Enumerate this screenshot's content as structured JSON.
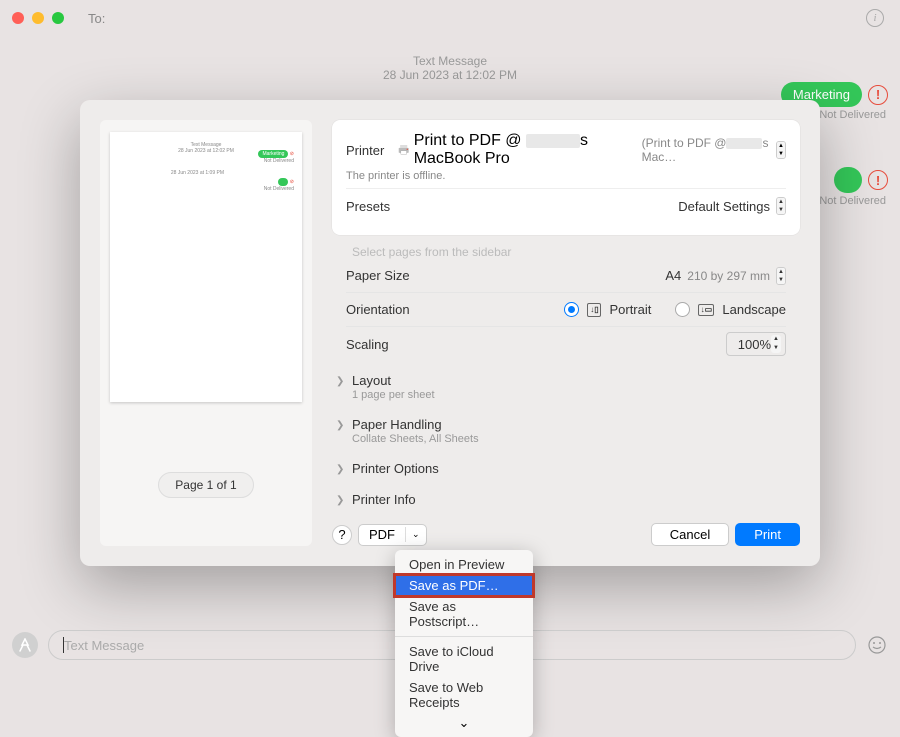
{
  "titlebar": {
    "to_label": "To:"
  },
  "header": {
    "type": "Text Message",
    "timestamp": "28 Jun 2023 at 12:02 PM"
  },
  "conversation": {
    "bubble1": "Marketing",
    "not_delivered": "Not Delivered"
  },
  "print": {
    "page_indicator": "Page 1 of 1",
    "printer_label": "Printer",
    "printer_name_pre": "Print to PDF @ ",
    "printer_name_post": "s MacBook Pro",
    "printer_sub_pre": "(Print to PDF @",
    "printer_sub_post": "s Mac…",
    "offline": "The printer is offline.",
    "presets_label": "Presets",
    "presets_value": "Default Settings",
    "faded_line": "Select pages from the sidebar",
    "paper_size_label": "Paper Size",
    "paper_size_value": "A4",
    "paper_size_dim": "210 by 297 mm",
    "orientation_label": "Orientation",
    "orientation_portrait": "Portrait",
    "orientation_landscape": "Landscape",
    "scaling_label": "Scaling",
    "scaling_value": "100%",
    "sections": {
      "layout": {
        "title": "Layout",
        "sub": "1 page per sheet"
      },
      "paper_handling": {
        "title": "Paper Handling",
        "sub": "Collate Sheets, All Sheets"
      },
      "printer_options": {
        "title": "Printer Options"
      },
      "printer_info": {
        "title": "Printer Info"
      }
    },
    "help": "?",
    "pdf_btn": "PDF",
    "cancel": "Cancel",
    "print_btn": "Print"
  },
  "pdf_menu": {
    "open_preview": "Open in Preview",
    "save_pdf": "Save as PDF…",
    "save_ps": "Save as Postscript…",
    "save_icloud": "Save to iCloud Drive",
    "save_receipts": "Save to Web Receipts"
  },
  "input_bar": {
    "placeholder": "Text Message"
  },
  "thumb": {
    "header1": "Text Message",
    "header2": "28 Jun 2023 at 12:02 PM",
    "bubble": "Marketing",
    "nd": "Not Delivered",
    "ts2": "28 Jun 2023 at 1:09 PM"
  }
}
